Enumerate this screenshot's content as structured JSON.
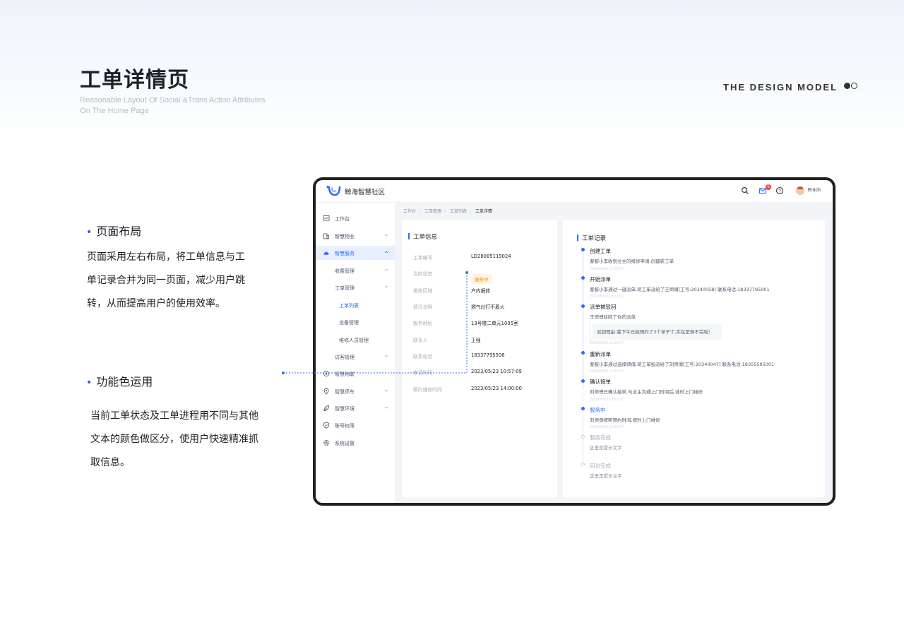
{
  "header": {
    "title": "工单详情页",
    "subtitle_line1": "Reasonable Layout Of Social &Trans Action Attributes",
    "subtitle_line2": "On The Home Page",
    "brand": "THE DESIGN MODEL"
  },
  "sections": [
    {
      "bullet": "•",
      "title": "页面布局",
      "lines": [
        "页面采用左右布局，将工单信息与工",
        "单记录合并为同一页面，减少用户跳",
        "转，从而提高用户的使用效率。"
      ]
    },
    {
      "bullet": "•",
      "title": "功能色运用",
      "lines": [
        "当前工单状态及工单进程用不同与其他",
        "文本的颜色做区分，使用户快速精准抓",
        "取信息。"
      ]
    }
  ],
  "app": {
    "name": "鲸海智慧社区",
    "notification_count": "5",
    "username": "Entch",
    "colors": {
      "primary": "#2f6bff",
      "warning": "#ff8a00",
      "danger": "#f53f3f"
    }
  },
  "sidebar": {
    "items": [
      {
        "label": "工作台",
        "icon": "dashboard-icon"
      },
      {
        "label": "智慧物业",
        "icon": "building-icon"
      },
      {
        "label": "智慧服务",
        "icon": "cloud-icon"
      },
      {
        "label": "收费管理"
      },
      {
        "label": "工单管理"
      },
      {
        "label": "工单列表"
      },
      {
        "label": "设备管理"
      },
      {
        "label": "维修人员管理"
      },
      {
        "label": "访客管理"
      },
      {
        "label": "智慧物联",
        "icon": "iot-icon"
      },
      {
        "label": "智慧停车",
        "icon": "location-icon"
      },
      {
        "label": "智慧环境",
        "icon": "leaf-icon"
      },
      {
        "label": "账号权限",
        "icon": "shield-icon"
      },
      {
        "label": "系统设置",
        "icon": "gear-icon"
      }
    ]
  },
  "breadcrumb": [
    "工作台",
    "工单管理",
    "工单列表",
    "工单详情"
  ],
  "info": {
    "title": "工单信息",
    "fields": [
      {
        "label": "工单编号",
        "value": "LD28085119024"
      },
      {
        "label": "当前状态",
        "value": "服务中"
      },
      {
        "label": "报修区域",
        "value": "户内报修"
      },
      {
        "label": "情况说明",
        "value": "燃气灶打不着火"
      },
      {
        "label": "服务地址",
        "value": "13号楼二单元1005室"
      },
      {
        "label": "联系人",
        "value": "王强"
      },
      {
        "label": "联系电话",
        "value": "18337795506"
      },
      {
        "label": "申请时间",
        "value": "2023/05/23   10:57:09"
      },
      {
        "label": "预约维修时间",
        "value": "2023/05/23   14:00:00"
      }
    ]
  },
  "records": {
    "title": "工单记录",
    "items": [
      {
        "title": "创建工单",
        "desc": "客服小李收到业主的报修申请,创建新工单",
        "time": "2022/05/23 12:53:07"
      },
      {
        "title": "开始派单",
        "desc": "客服小李通过一键派单,将工单派给了王师傅[工号:20340058]  联系电话:18337795001",
        "time": "2022/05/23 12:53:07"
      },
      {
        "title": "派单被驳回",
        "desc": "王师傅驳回了你的派单",
        "reason": "驳回理由:我下午已经预约了3个单子了,实在是做不完啦!",
        "time": "2022/05/23 12:53:07"
      },
      {
        "title": "重新派单",
        "desc": "客服小李通过选择师傅,将工单指派给了刘师傅[工号:20340047]  联系电话:18355595001",
        "time": "2022/05/23 12:53:07"
      },
      {
        "title": "确认接单",
        "desc": "刘师傅已确认接单,与业主沟通上门时间后,准时上门维修",
        "time": "2022/05/23 12:53:07"
      },
      {
        "title": "服务中",
        "desc": "刘师傅按照预约时间,按时上门维修",
        "time": "2022/05/23 12:53:07"
      },
      {
        "title": "服务完成",
        "desc": "这里是提示文字"
      },
      {
        "title": "回访完成",
        "desc": "这里是提示文字"
      }
    ]
  }
}
